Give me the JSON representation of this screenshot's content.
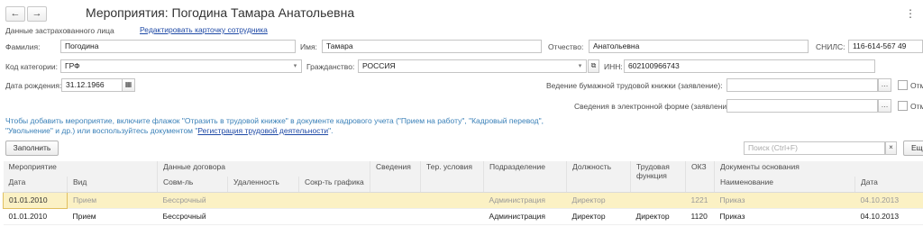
{
  "window": {
    "title": "Мероприятия: Погодина Тамара Анатольевна",
    "back_icon": "←",
    "forward_icon": "→",
    "menu_icon": "⋮"
  },
  "insured": {
    "section_label": "Данные застрахованного лица",
    "edit_link": "Редактировать карточку сотрудника"
  },
  "person": {
    "surname_label": "Фамилия:",
    "surname": "Погодина",
    "name_label": "Имя:",
    "name": "Тамара",
    "patronymic_label": "Отчество:",
    "patronymic": "Анатольевна",
    "snils_label": "СНИЛС:",
    "snils": "116-614-567 49",
    "category_label": "Код категории:",
    "category": "ГРФ",
    "citizenship_label": "Гражданство:",
    "citizenship": "РОССИЯ",
    "inn_label": "ИНН:",
    "inn": "602100966743",
    "birth_label": "Дата рождения:",
    "birth": "31.12.1966"
  },
  "workbook": {
    "paper_label": "Ведение бумажной трудовой книжки (заявление):",
    "paper_value": "",
    "electronic_label": "Сведения в электронной форме (заявление):",
    "electronic_value": "",
    "cut_label": "Отм"
  },
  "hint": {
    "part1": "Чтобы добавить мероприятие, включите флажок \"Отразить в трудовой книжке\" в документе кадрового учета (\"Прием на работу\", \"Кадровый перевод\",",
    "part2": "\"Увольнение\" и др.) или воспользуйтесь документом \"",
    "link": "Регистрация трудовой деятельности",
    "part3": "\"."
  },
  "toolbar": {
    "fill_button": "Заполнить",
    "search_placeholder": "Поиск (Ctrl+F)",
    "clear": "×",
    "more_button": "Ещ"
  },
  "table": {
    "group_headers": {
      "event": "Мероприятие",
      "contract": "Данные договора",
      "info": "Сведения",
      "conditions": "Тер. условия",
      "division": "Подразделение",
      "position": "Должность",
      "function": "Трудовая функция",
      "okz": "ОКЗ",
      "docs": "Документы основания"
    },
    "sub_headers": {
      "date": "Дата",
      "kind": "Вид",
      "combination": "Совм-ль",
      "remote": "Удаленность",
      "reduced": "Сокр-ть графика",
      "doc_name": "Наименование",
      "doc_date": "Дата"
    },
    "rows": [
      {
        "date": "01.01.2010",
        "kind": "Прием",
        "combination": "Бессрочный",
        "remote": "",
        "reduced": "",
        "info": "",
        "conditions": "",
        "division": "Администрация",
        "position": "Директор",
        "function": "",
        "okz": "1221",
        "doc_name": "Приказ",
        "doc_date": "04.10.2013"
      },
      {
        "date": "01.01.2010",
        "kind": "Прием",
        "combination": "Бессрочный",
        "remote": "",
        "reduced": "",
        "info": "",
        "conditions": "",
        "division": "Администрация",
        "position": "Директор",
        "function": "Директор",
        "okz": "1120",
        "doc_name": "Приказ",
        "doc_date": "04.10.2013"
      }
    ]
  }
}
